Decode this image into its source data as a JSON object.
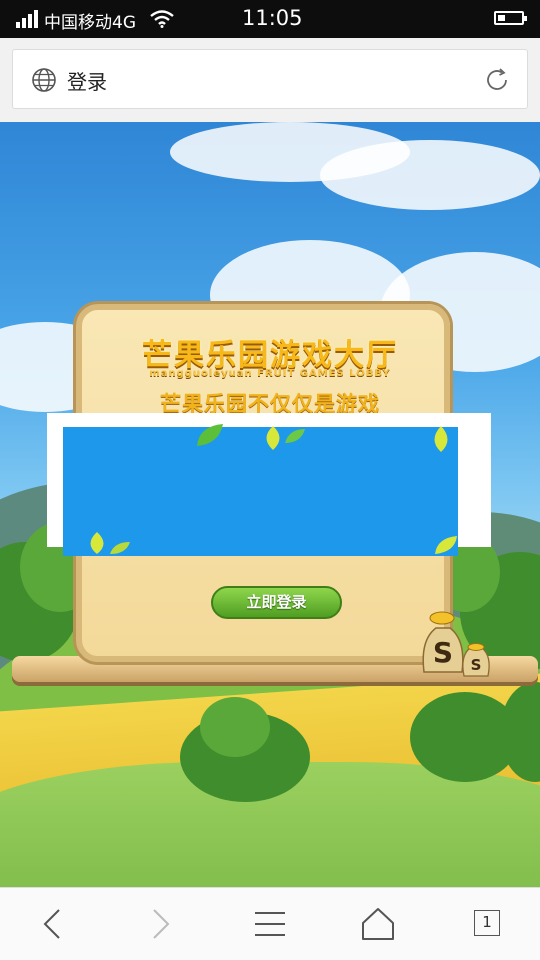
{
  "status_bar": {
    "carrier": "中国移动4G",
    "time": "11:05"
  },
  "address_bar": {
    "page_title": "登录",
    "icons": [
      "globe-icon",
      "reload-icon"
    ]
  },
  "web_page": {
    "game_title": "芒果乐园游戏大厅",
    "game_subtitle": "mangguoleyuan FRUIT GAMES LOBBY",
    "game_slogan": "芒果乐园不仅仅是游戏",
    "login_button": "立即登录",
    "popup_color": "#1e98ea"
  },
  "bottom_nav": {
    "tab_count": "1",
    "icons": [
      "back-icon",
      "forward-icon",
      "menu-icon",
      "home-icon",
      "tabs-icon"
    ]
  }
}
